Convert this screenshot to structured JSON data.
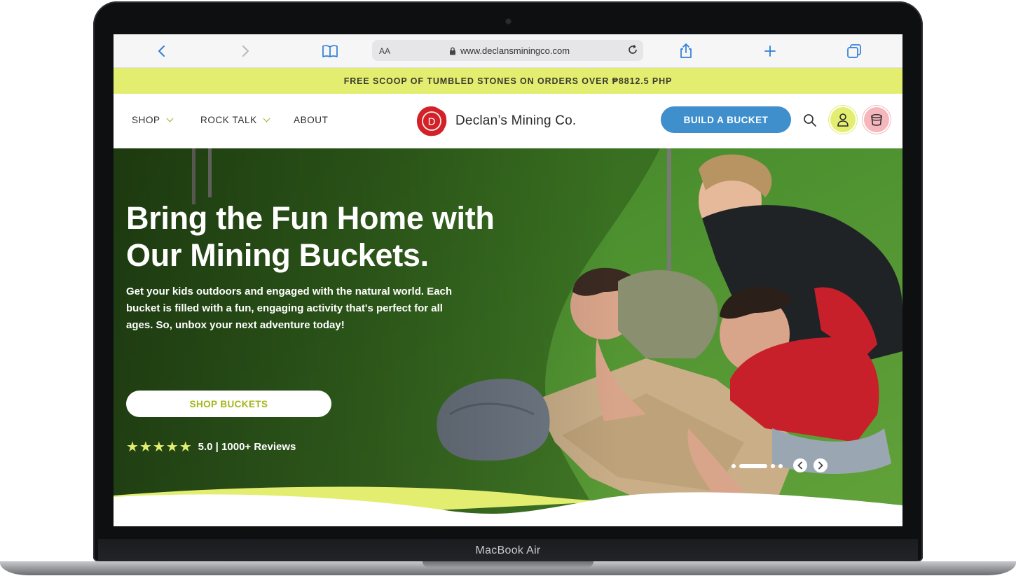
{
  "device": {
    "label": "MacBook Air"
  },
  "browser": {
    "reader_label": "AA",
    "url": "www.declansminingco.com",
    "icons": [
      "back-icon",
      "forward-icon",
      "bookmarks-icon",
      "lock-icon",
      "reload-icon",
      "share-icon",
      "new-tab-icon",
      "tabs-icon"
    ]
  },
  "promo": {
    "text": "FREE SCOOP OF TUMBLED STONES ON ORDERS OVER ₱8812.5 PHP"
  },
  "nav": {
    "items": [
      {
        "label": "SHOP",
        "has_dropdown": true
      },
      {
        "label": "ROCK TALK",
        "has_dropdown": true
      },
      {
        "label": "ABOUT",
        "has_dropdown": false
      }
    ]
  },
  "brand": {
    "logo_letter": "D",
    "name": "Declan’s Mining Co.",
    "color": "#d42027"
  },
  "header": {
    "cta_label": "BUILD A BUCKET",
    "cta_color": "#3f8fcd",
    "account_bg": "#e3ee70",
    "cart_bg": "#f5b6bc"
  },
  "hero": {
    "title": "Bring the Fun Home with Our Mining Buckets.",
    "subtitle": "Get your kids outdoors and engaged with the natural world. Each bucket is filled with a fun, engaging activity that's perfect for all ages. So, unbox your next adventure today!",
    "button_label": "SHOP BUCKETS",
    "stars": "★★★★★",
    "rating_text": "5.0 | 1000+ Reviews",
    "rating_value": 5.0,
    "slides_count": 4,
    "active_slide": 2,
    "accent": "#e3ee70"
  }
}
